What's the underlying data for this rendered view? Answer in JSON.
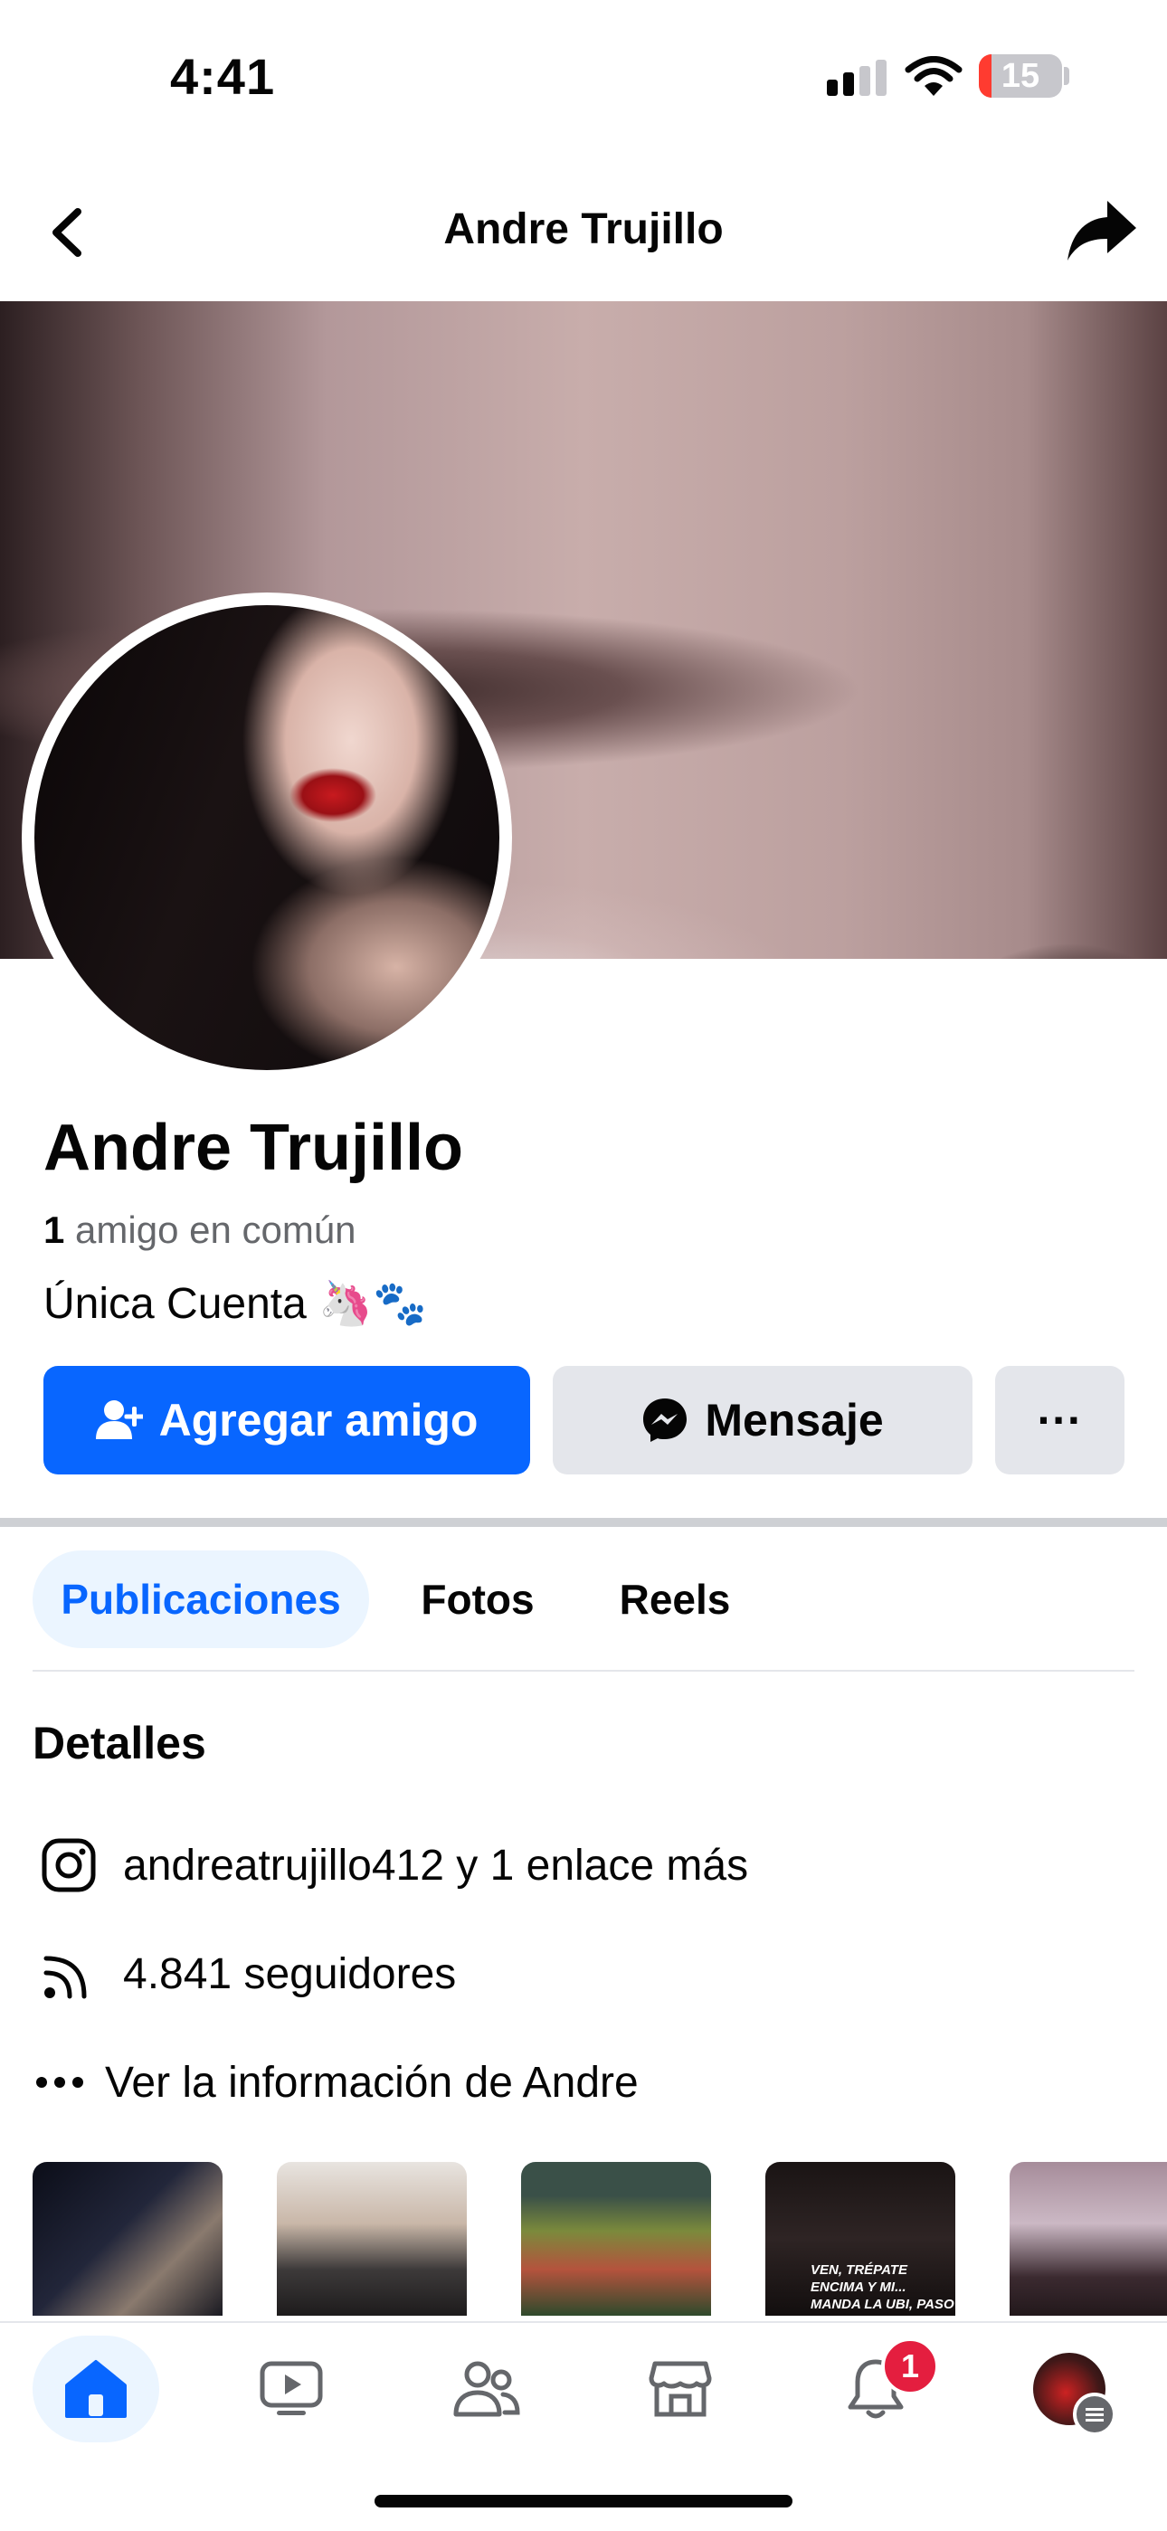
{
  "status_bar": {
    "time": "4:41",
    "battery": "15",
    "battery_level": 0.15
  },
  "header": {
    "title": "Andre Trujillo"
  },
  "profile": {
    "name": "Andre Trujillo",
    "mutual_count": "1",
    "mutual_text": " amigo en común",
    "bio": "Única Cuenta 🦄🐾"
  },
  "actions": {
    "add_friend": "Agregar amigo",
    "message": "Mensaje",
    "more": "···"
  },
  "tabs": [
    {
      "label": "Publicaciones",
      "active": true
    },
    {
      "label": "Fotos"
    },
    {
      "label": "Reels"
    }
  ],
  "details": {
    "title": "Detalles",
    "instagram": "andreatrujillo412 y 1 enlace más",
    "followers": "4.841 seguidores",
    "about": "Ver la información de Andre"
  },
  "photos": {
    "thumb4_caption": "VEN, TRÉPATE ENCIMA Y MI... MANDA LA UBI, PASO POR TI"
  },
  "bottom_nav": {
    "notifications_badge": "1"
  },
  "colors": {
    "accent": "#0866ff",
    "secondary_button": "#e4e6eb",
    "badge": "#e41e3f"
  },
  "icons": [
    "back-icon",
    "share-icon",
    "add-friend-icon",
    "messenger-icon",
    "instagram-icon",
    "rss-icon",
    "more-dots-icon",
    "home-icon",
    "video-icon",
    "friends-icon",
    "marketplace-icon",
    "bell-icon"
  ]
}
